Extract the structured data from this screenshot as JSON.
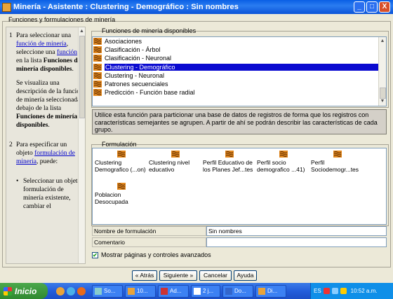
{
  "window": {
    "title": "Minería - Asistente : Clustering - Demográfico : Sin nombres",
    "minimize_glyph": "_",
    "maximize_glyph": "□",
    "close_glyph": "X"
  },
  "group_title": "Funciones y formulaciones de minería",
  "help": {
    "item1_num": "1",
    "item1_text1": "Para seleccionar una",
    "item1_link1": "función de minería",
    "item1_text2": ", seleccione una",
    "item1_link2": "función",
    "item1_text3": " en la lista",
    "item1_bold": "Funciones de minería disponibles",
    "item1_text4": ".",
    "item1_para2_a": "Se visualiza una descripción de la función de minería seleccionada debajo de la lista ",
    "item1_para2_bold": "Funciones de minería disponibles",
    "item1_para2_b": ".",
    "item2_num": "2",
    "item2_text1": "Para especificar un objeto ",
    "item2_link": "formulación de minería",
    "item2_text2": ", puede:",
    "bullet_glyph": "•",
    "bullet1": "Seleccionar un objeto formulación de minería existente, cambiar el"
  },
  "functions": {
    "caption": "Funciones de minería disponibles",
    "items": [
      {
        "label": "Asociaciones"
      },
      {
        "label": "Clasificación - Árbol"
      },
      {
        "label": "Clasificación - Neuronal"
      },
      {
        "label": "Clustering - Demográfico"
      },
      {
        "label": "Clustering - Neuronal"
      },
      {
        "label": "Patrones secuenciales"
      },
      {
        "label": "Predicción - Función base radial"
      }
    ],
    "selected_index": 3,
    "description": "Utilice esta función para particionar una base de datos de registros de forma que los registros con características semejantes se agrupen. A partir de ahí se podrán describir las características de cada grupo."
  },
  "formulation": {
    "caption": "Formulación",
    "items": [
      {
        "line1": "Clustering",
        "line2": "Demografico (...on)"
      },
      {
        "line1": "Clustering nivel",
        "line2": "educativo"
      },
      {
        "line1": "Perfil Educativo de",
        "line2": "los Planes Jef...tes"
      },
      {
        "line1": "Perfil socio",
        "line2": "demografico ...41)"
      },
      {
        "line1": "Perfil",
        "line2": "Sociodemogr...tes"
      },
      {
        "line1": "Poblacion",
        "line2": "Desocupada"
      }
    ]
  },
  "fields": {
    "name_label": "Nombre de formulación",
    "name_value": "Sin nombres",
    "comment_label": "Comentario",
    "comment_value": ""
  },
  "advanced": {
    "label": "Mostrar páginas y controles avanzados",
    "check_glyph": "✔",
    "checked": true
  },
  "buttons": {
    "back": "« Atrás",
    "next": "Siguiente »",
    "cancel": "Cancelar",
    "help": "Ayuda"
  },
  "taskbar": {
    "start": "Inicio",
    "tasks": [
      {
        "label": "So..."
      },
      {
        "label": "10..."
      },
      {
        "label": "Ad..."
      },
      {
        "label": "2 j..."
      },
      {
        "label": "Do..."
      },
      {
        "label": "Di..."
      }
    ],
    "lang": "ES",
    "clock": "10:52 a.m."
  },
  "colors": {
    "selection": "#0a0ad0",
    "icon_orange": "#e58a1f",
    "link": "#0000cc"
  }
}
